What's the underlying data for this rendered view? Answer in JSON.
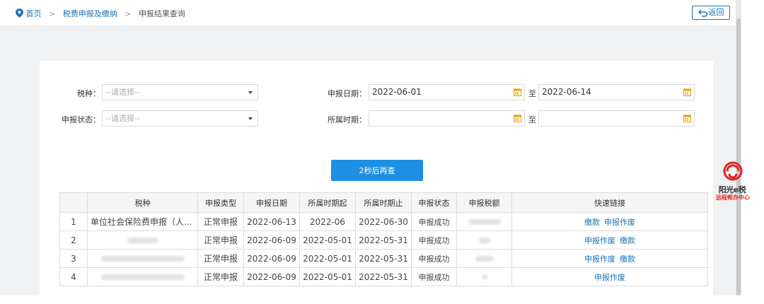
{
  "breadcrumb": {
    "home": "首页",
    "separator": ">",
    "level1": "税费申报及缴纳",
    "current": "申报结果查询"
  },
  "back_button": "返回",
  "filters": {
    "tax_type_label": "税种：",
    "tax_type_placeholder": "--请选择--",
    "status_label": "申报状态：",
    "status_placeholder": "--请选择--",
    "declare_date_label": "申报日期：",
    "declare_date_from": "2022-06-01",
    "declare_date_to": "2022-06-14",
    "period_label": "所属时期：",
    "period_from": "",
    "period_to": "",
    "to_text": "至"
  },
  "query_button": "2秒后再查",
  "table": {
    "headers": [
      "",
      "税种",
      "申报类型",
      "申报日期",
      "所属时期起",
      "所属时期止",
      "申报状态",
      "申报税额",
      "快速链接"
    ],
    "rows": [
      {
        "index": "1",
        "tax_name": "单位社会保险费申报（人...",
        "type": "正常申报",
        "date": "2022-06-13",
        "period_start": "2022-06",
        "period_end": "2022-06-30",
        "status": "申报成功",
        "links": [
          "缴款",
          "申报作废"
        ]
      },
      {
        "index": "2",
        "tax_name": "",
        "type": "正常申报",
        "date": "2022-06-09",
        "period_start": "2022-05-01",
        "period_end": "2022-05-31",
        "status": "申报成功",
        "links": [
          "申报作废",
          "缴款"
        ]
      },
      {
        "index": "3",
        "tax_name": "",
        "type": "正常申报",
        "date": "2022-06-09",
        "period_start": "2022-05-01",
        "period_end": "2022-05-31",
        "status": "申报成功",
        "links": [
          "申报作废",
          "缴款"
        ]
      },
      {
        "index": "4",
        "tax_name": "",
        "type": "正常申报",
        "date": "2022-06-09",
        "period_start": "2022-05-01",
        "period_end": "2022-05-31",
        "status": "申报成功",
        "links": [
          "申报作废"
        ]
      }
    ]
  },
  "logo": {
    "brand": "阳光e税",
    "subtitle": "远程帮办中心"
  },
  "colors": {
    "link": "#1a73b8",
    "primary_button": "#1e8fe3",
    "calendar_icon": "#e6a100",
    "background": "#f0f1f3"
  }
}
